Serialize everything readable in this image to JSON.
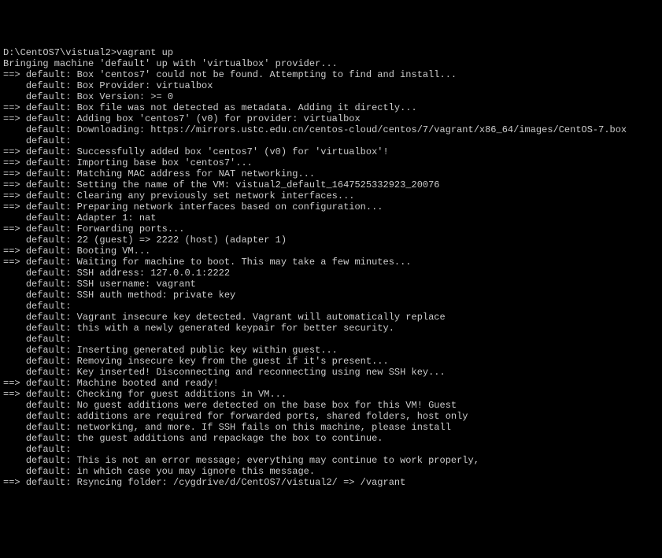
{
  "prompt": "D:\\CentOS7\\vistual2>",
  "command": "vagrant up",
  "lines": [
    {
      "prefix": "",
      "text": "Bringing machine 'default' up with 'virtualbox' provider..."
    },
    {
      "prefix": "==> ",
      "text": "default: Box 'centos7' could not be found. Attempting to find and install..."
    },
    {
      "prefix": "    ",
      "text": "default: Box Provider: virtualbox"
    },
    {
      "prefix": "    ",
      "text": "default: Box Version: >= 0"
    },
    {
      "prefix": "==> ",
      "text": "default: Box file was not detected as metadata. Adding it directly..."
    },
    {
      "prefix": "==> ",
      "text": "default: Adding box 'centos7' (v0) for provider: virtualbox"
    },
    {
      "prefix": "    ",
      "text": "default: Downloading: https://mirrors.ustc.edu.cn/centos-cloud/centos/7/vagrant/x86_64/images/CentOS-7.box"
    },
    {
      "prefix": "    ",
      "text": "default:"
    },
    {
      "prefix": "==> ",
      "text": "default: Successfully added box 'centos7' (v0) for 'virtualbox'!"
    },
    {
      "prefix": "==> ",
      "text": "default: Importing base box 'centos7'..."
    },
    {
      "prefix": "==> ",
      "text": "default: Matching MAC address for NAT networking..."
    },
    {
      "prefix": "==> ",
      "text": "default: Setting the name of the VM: vistual2_default_1647525332923_20076"
    },
    {
      "prefix": "==> ",
      "text": "default: Clearing any previously set network interfaces..."
    },
    {
      "prefix": "==> ",
      "text": "default: Preparing network interfaces based on configuration..."
    },
    {
      "prefix": "    ",
      "text": "default: Adapter 1: nat"
    },
    {
      "prefix": "==> ",
      "text": "default: Forwarding ports..."
    },
    {
      "prefix": "    ",
      "text": "default: 22 (guest) => 2222 (host) (adapter 1)"
    },
    {
      "prefix": "==> ",
      "text": "default: Booting VM..."
    },
    {
      "prefix": "==> ",
      "text": "default: Waiting for machine to boot. This may take a few minutes..."
    },
    {
      "prefix": "    ",
      "text": "default: SSH address: 127.0.0.1:2222"
    },
    {
      "prefix": "    ",
      "text": "default: SSH username: vagrant"
    },
    {
      "prefix": "    ",
      "text": "default: SSH auth method: private key"
    },
    {
      "prefix": "    ",
      "text": "default:"
    },
    {
      "prefix": "    ",
      "text": "default: Vagrant insecure key detected. Vagrant will automatically replace"
    },
    {
      "prefix": "    ",
      "text": "default: this with a newly generated keypair for better security."
    },
    {
      "prefix": "    ",
      "text": "default:"
    },
    {
      "prefix": "    ",
      "text": "default: Inserting generated public key within guest..."
    },
    {
      "prefix": "    ",
      "text": "default: Removing insecure key from the guest if it's present..."
    },
    {
      "prefix": "    ",
      "text": "default: Key inserted! Disconnecting and reconnecting using new SSH key..."
    },
    {
      "prefix": "==> ",
      "text": "default: Machine booted and ready!"
    },
    {
      "prefix": "==> ",
      "text": "default: Checking for guest additions in VM..."
    },
    {
      "prefix": "    ",
      "text": "default: No guest additions were detected on the base box for this VM! Guest"
    },
    {
      "prefix": "    ",
      "text": "default: additions are required for forwarded ports, shared folders, host only"
    },
    {
      "prefix": "    ",
      "text": "default: networking, and more. If SSH fails on this machine, please install"
    },
    {
      "prefix": "    ",
      "text": "default: the guest additions and repackage the box to continue."
    },
    {
      "prefix": "    ",
      "text": "default:"
    },
    {
      "prefix": "    ",
      "text": "default: This is not an error message; everything may continue to work properly,"
    },
    {
      "prefix": "    ",
      "text": "default: in which case you may ignore this message."
    },
    {
      "prefix": "==> ",
      "text": "default: Rsyncing folder: /cygdrive/d/CentOS7/vistual2/ => /vagrant"
    }
  ]
}
